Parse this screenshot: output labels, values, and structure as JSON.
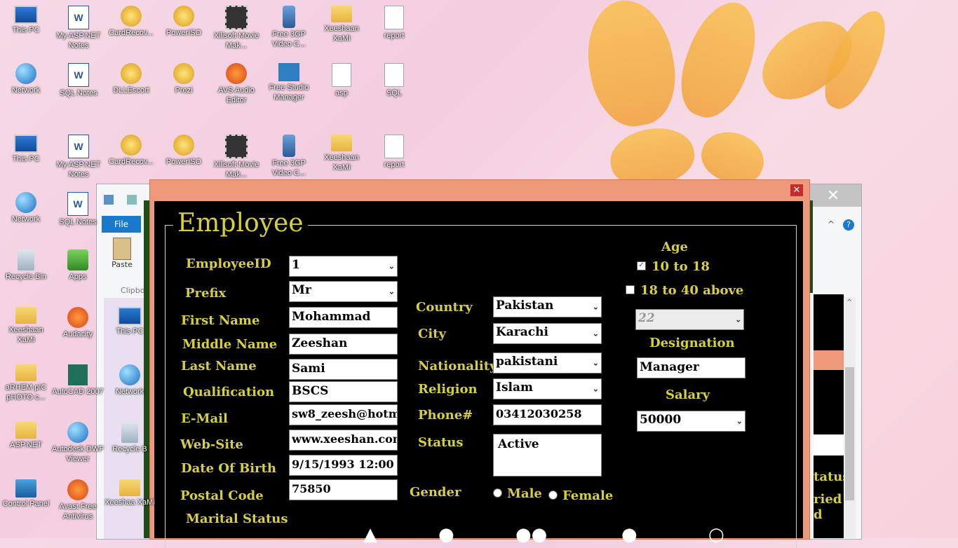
{
  "desktop": {
    "row1": [
      "This PC",
      "My ASP.NET Notes",
      "CardRecov...",
      "PowerISO",
      "Xilisoft Movie Mak...",
      "Free 3GP Video C...",
      "Xeeshaan XaMi",
      "report"
    ],
    "row2": [
      "Network",
      "SQL Notes",
      "DLLEscort",
      "Prezi",
      "AVS Audio Editor",
      "Free Studio Manager",
      "asp",
      "SQL"
    ],
    "row3": [
      "This PC",
      "My ASP.NET Notes",
      "CardRecov...",
      "PowerISO",
      "Xilisoft Movie Mak...",
      "Free 3GP Video C...",
      "Xeeshaan XaMi",
      "report"
    ],
    "col1": [
      "Network",
      "Recycle Bin",
      "Xeeshaan XaMi",
      "aRHEM pIC pHOTO c...",
      "ASP.NET",
      "Control Panel"
    ],
    "col2": [
      "SQL Notes",
      "Apps",
      "Audacity",
      "AutoCAD 2007",
      "Autodesk DWF Viewer",
      "Avast Free Antivirus"
    ],
    "col3": [
      "This PC",
      "Network",
      "Recycle B",
      "Xeeshaa XaMi"
    ]
  },
  "explorer": {
    "file_tab": "File",
    "paste_label": "Paste",
    "clipboard_label": "Clipbo",
    "close_glyph": "✕"
  },
  "form": {
    "title": "Employee",
    "close_glyph": "✕",
    "fields": {
      "employee_id": {
        "label": "EmployeeID",
        "value": "1"
      },
      "prefix": {
        "label": "Prefix",
        "value": "Mr"
      },
      "first_name": {
        "label": "First Name",
        "value": "Mohammad"
      },
      "middle_name": {
        "label": "Middle Name",
        "value": "Zeeshan"
      },
      "last_name": {
        "label": "Last Name",
        "value": "Sami"
      },
      "qualification": {
        "label": "Qualification",
        "value": "BSCS"
      },
      "email": {
        "label": "E-Mail",
        "value": "sw8_zeesh@hotm"
      },
      "website": {
        "label": "Web-Site",
        "value": "www.xeeshan.com"
      },
      "dob": {
        "label": "Date Of Birth",
        "value": "9/15/1993 12:00"
      },
      "postal_code": {
        "label": "Postal Code",
        "value": "75850"
      },
      "marital_status": {
        "label": "Marital Status"
      },
      "country": {
        "label": "Country",
        "value": "Pakistan"
      },
      "city": {
        "label": "City",
        "value": "Karachi"
      },
      "nationality": {
        "label": "Nationality",
        "value": "pakistani"
      },
      "religion": {
        "label": "Religion",
        "value": "Islam"
      },
      "phone": {
        "label": "Phone#",
        "value": "03412030258"
      },
      "status": {
        "label": "Status",
        "value": "Active"
      },
      "gender": {
        "label": "Gender",
        "male": "Male",
        "female": "Female"
      },
      "age": {
        "label": "Age",
        "opt1": "10 to 18",
        "opt2": "18 to 40 above",
        "value": "22"
      },
      "designation": {
        "label": "Designation",
        "value": "Manager"
      },
      "salary": {
        "label": "Salary",
        "value": "50000"
      }
    }
  },
  "right_fragments": {
    "line1": "tatus",
    "line2": "ried",
    "line3": "d"
  },
  "colors": {
    "label_gold": "#d8cf3c",
    "form_bg": "#000000",
    "frame_salmon": "#f0987a"
  }
}
